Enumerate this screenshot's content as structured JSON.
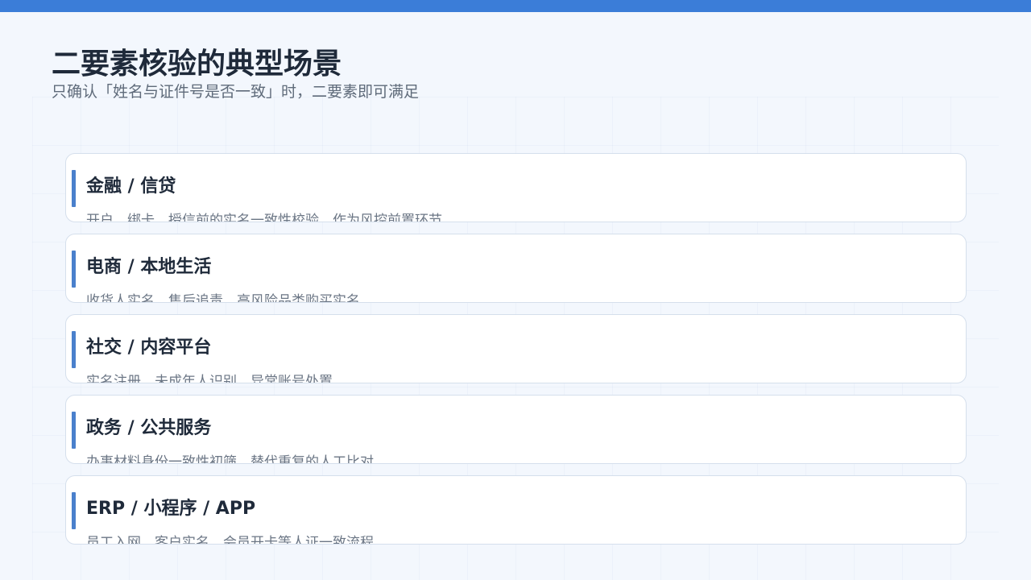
{
  "header": {
    "title": "二要素核验的典型场景",
    "subtitle": "只确认「姓名与证件号是否一致」时，二要素即可满足"
  },
  "scenarios": [
    {
      "title": "金融 / 信贷",
      "description": "开户、绑卡、授信前的实名一致性校验，作为风控前置环节"
    },
    {
      "title": "电商 / 本地生活",
      "description": "收货人实名、售后追责、高风险品类购买实名"
    },
    {
      "title": "社交 / 内容平台",
      "description": "实名注册、未成年人识别、异常账号处置"
    },
    {
      "title": "政务 / 公共服务",
      "description": "办事材料身份一致性初筛，替代重复的人工比对"
    },
    {
      "title": "ERP / 小程序 / APP",
      "description": "员工入网、客户实名、会员开卡等人证一致流程"
    }
  ],
  "colors": {
    "accent": "#3b7dd8",
    "card_accent": "#4a80cc",
    "background": "#f3f7fd"
  }
}
